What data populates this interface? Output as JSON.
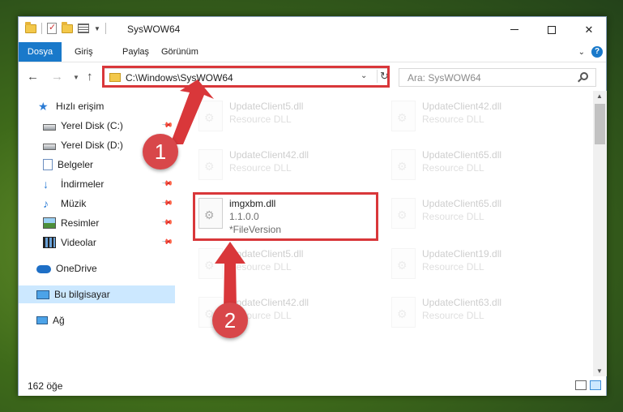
{
  "window": {
    "title": "SysWOW64"
  },
  "ribbon": {
    "tabs": [
      "Dosya",
      "Giriş",
      "Paylaş",
      "Görünüm"
    ],
    "help": "?"
  },
  "address": {
    "path": "C:\\Windows\\SysWOW64",
    "search_placeholder": "Ara: SysWOW64"
  },
  "nav": {
    "items": [
      {
        "label": "Hızlı erişim",
        "icon": "quick-access-star-icon"
      },
      {
        "label": "Yerel Disk (C:)",
        "icon": "drive-icon",
        "pinned": true
      },
      {
        "label": "Yerel Disk (D:)",
        "icon": "drive-icon"
      },
      {
        "label": "Belgeler",
        "icon": "documents-icon",
        "pinned": true
      },
      {
        "label": "İndirmeler",
        "icon": "downloads-icon",
        "pinned": true
      },
      {
        "label": "Müzik",
        "icon": "music-icon",
        "pinned": true
      },
      {
        "label": "Resimler",
        "icon": "pictures-icon",
        "pinned": true
      },
      {
        "label": "Videolar",
        "icon": "videos-icon",
        "pinned": true
      },
      {
        "label": "OneDrive",
        "icon": "onedrive-cloud-icon"
      },
      {
        "label": "Bu bilgisayar",
        "icon": "this-pc-icon",
        "selected": true
      },
      {
        "label": "Ağ",
        "icon": "network-icon"
      }
    ]
  },
  "files": [
    {
      "name": "UpdateClient5.dll",
      "desc": "Resource DLL"
    },
    {
      "name": "UpdateClient42.dll",
      "desc": "Resource DLL"
    },
    {
      "name": "UpdateClient42.dll",
      "desc": "Resource DLL"
    },
    {
      "name": "UpdateClient65.dll",
      "desc": "Resource DLL"
    },
    {
      "name": "imgxbm.dll",
      "desc": "1.1.0.0",
      "desc2": "*FileVersion",
      "highlighted": true
    },
    {
      "name": "UpdateClient65.dll",
      "desc": "Resource DLL"
    },
    {
      "name": "UpdateClient5.dll",
      "desc": "Resource DLL"
    },
    {
      "name": "UpdateClient19.dll",
      "desc": "Resource DLL"
    },
    {
      "name": "UpdateClient42.dll",
      "desc": "Resource DLL"
    },
    {
      "name": "UpdateClient63.dll",
      "desc": "Resource DLL"
    }
  ],
  "status": {
    "count": "162 öğe"
  },
  "annotations": {
    "step1": "1",
    "step2": "2",
    "color": "#d9373a"
  }
}
